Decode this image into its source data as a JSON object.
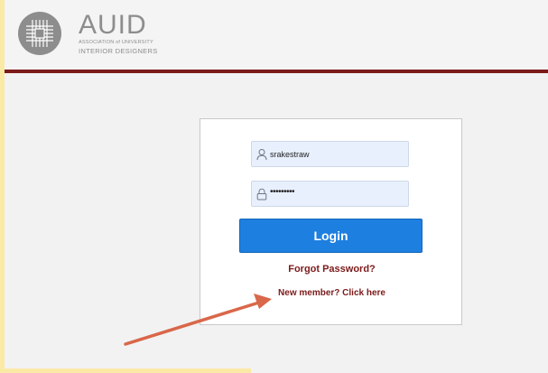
{
  "logo": {
    "icon": "auid-grid-logo-icon",
    "wordmark": "AUID",
    "subtitle_line1": "ASSOCIATION of UNIVERSITY",
    "subtitle_line2": "INTERIOR DESIGNERS"
  },
  "login_form": {
    "username_value": "srakestraw",
    "username_icon": "user-icon",
    "password_value": "•••••••••",
    "password_icon": "lock-icon",
    "login_label": "Login",
    "forgot_label": "Forgot Password?",
    "new_member_label": "New member? Click here"
  },
  "annotation": {
    "arrow_icon": "pointer-arrow-annotation",
    "arrow_color": "#d9674a"
  },
  "colors": {
    "brand_maroon": "#7d1a1a",
    "button_blue": "#1d7fe0",
    "field_fill": "#e8f0fe",
    "accent_yellow": "#fbe9a6"
  }
}
